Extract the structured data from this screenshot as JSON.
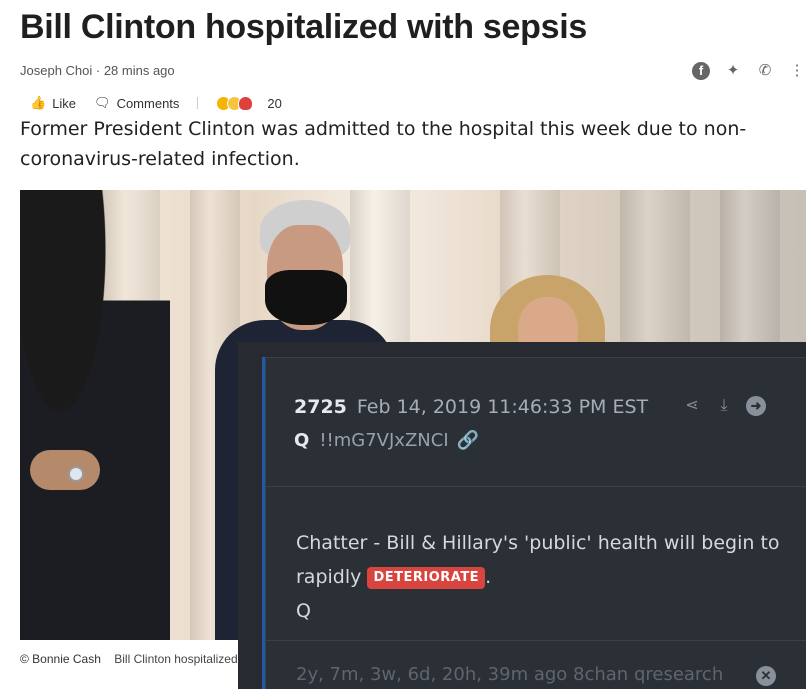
{
  "article": {
    "headline": "Bill Clinton hospitalized with sepsis",
    "byline": "Joseph Choi · 28 mins ago",
    "lede": "Former President Clinton was admitted to the hospital this week due to non-coronavirus-related infection."
  },
  "share_icons": [
    "facebook-icon",
    "twitter-icon",
    "whatsapp-icon",
    "more-icon"
  ],
  "actions": {
    "like_label": "Like",
    "comments_label": "Comments",
    "reaction_count": "20"
  },
  "photo": {
    "credit": "© Bonnie Cash",
    "caption": "Bill Clinton hospitalized"
  },
  "qpost": {
    "number": "2725",
    "date": "Feb 14, 2019 11:46:33 PM EST",
    "author": "Q",
    "tripcode": "!!mG7VJxZNCI",
    "body_prefix": "Chatter - Bill & Hillary's 'public' health will begin to rapidly",
    "badge": "DETERIORATE",
    "body_suffix": ".",
    "signature": "Q",
    "footer": "2y, 7m, 3w, 6d, 20h, 39m ago 8chan qresearch"
  },
  "colors": {
    "card_bg": "#2b2f36",
    "accent": "#1e5ba8",
    "badge": "#d8453f"
  }
}
